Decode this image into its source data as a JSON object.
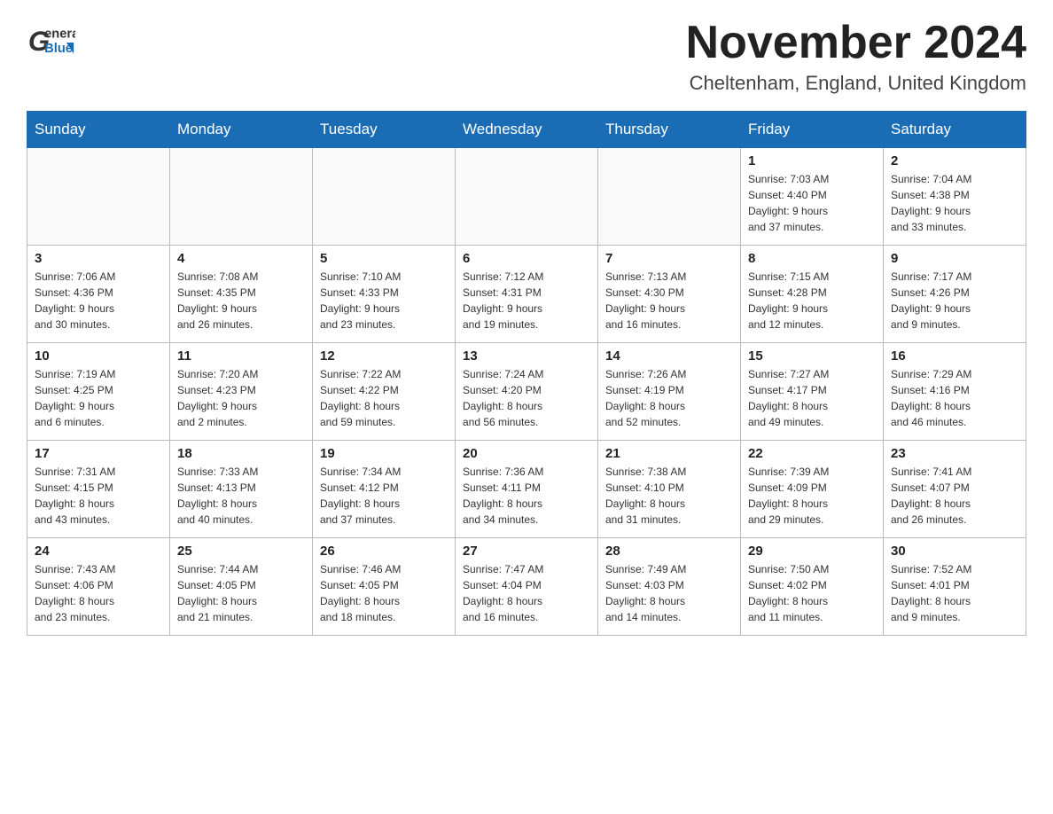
{
  "header": {
    "month_title": "November 2024",
    "location": "Cheltenham, England, United Kingdom",
    "logo_general": "General",
    "logo_blue": "Blue"
  },
  "days_of_week": [
    "Sunday",
    "Monday",
    "Tuesday",
    "Wednesday",
    "Thursday",
    "Friday",
    "Saturday"
  ],
  "weeks": [
    {
      "days": [
        {
          "number": "",
          "info": ""
        },
        {
          "number": "",
          "info": ""
        },
        {
          "number": "",
          "info": ""
        },
        {
          "number": "",
          "info": ""
        },
        {
          "number": "",
          "info": ""
        },
        {
          "number": "1",
          "info": "Sunrise: 7:03 AM\nSunset: 4:40 PM\nDaylight: 9 hours\nand 37 minutes."
        },
        {
          "number": "2",
          "info": "Sunrise: 7:04 AM\nSunset: 4:38 PM\nDaylight: 9 hours\nand 33 minutes."
        }
      ]
    },
    {
      "days": [
        {
          "number": "3",
          "info": "Sunrise: 7:06 AM\nSunset: 4:36 PM\nDaylight: 9 hours\nand 30 minutes."
        },
        {
          "number": "4",
          "info": "Sunrise: 7:08 AM\nSunset: 4:35 PM\nDaylight: 9 hours\nand 26 minutes."
        },
        {
          "number": "5",
          "info": "Sunrise: 7:10 AM\nSunset: 4:33 PM\nDaylight: 9 hours\nand 23 minutes."
        },
        {
          "number": "6",
          "info": "Sunrise: 7:12 AM\nSunset: 4:31 PM\nDaylight: 9 hours\nand 19 minutes."
        },
        {
          "number": "7",
          "info": "Sunrise: 7:13 AM\nSunset: 4:30 PM\nDaylight: 9 hours\nand 16 minutes."
        },
        {
          "number": "8",
          "info": "Sunrise: 7:15 AM\nSunset: 4:28 PM\nDaylight: 9 hours\nand 12 minutes."
        },
        {
          "number": "9",
          "info": "Sunrise: 7:17 AM\nSunset: 4:26 PM\nDaylight: 9 hours\nand 9 minutes."
        }
      ]
    },
    {
      "days": [
        {
          "number": "10",
          "info": "Sunrise: 7:19 AM\nSunset: 4:25 PM\nDaylight: 9 hours\nand 6 minutes."
        },
        {
          "number": "11",
          "info": "Sunrise: 7:20 AM\nSunset: 4:23 PM\nDaylight: 9 hours\nand 2 minutes."
        },
        {
          "number": "12",
          "info": "Sunrise: 7:22 AM\nSunset: 4:22 PM\nDaylight: 8 hours\nand 59 minutes."
        },
        {
          "number": "13",
          "info": "Sunrise: 7:24 AM\nSunset: 4:20 PM\nDaylight: 8 hours\nand 56 minutes."
        },
        {
          "number": "14",
          "info": "Sunrise: 7:26 AM\nSunset: 4:19 PM\nDaylight: 8 hours\nand 52 minutes."
        },
        {
          "number": "15",
          "info": "Sunrise: 7:27 AM\nSunset: 4:17 PM\nDaylight: 8 hours\nand 49 minutes."
        },
        {
          "number": "16",
          "info": "Sunrise: 7:29 AM\nSunset: 4:16 PM\nDaylight: 8 hours\nand 46 minutes."
        }
      ]
    },
    {
      "days": [
        {
          "number": "17",
          "info": "Sunrise: 7:31 AM\nSunset: 4:15 PM\nDaylight: 8 hours\nand 43 minutes."
        },
        {
          "number": "18",
          "info": "Sunrise: 7:33 AM\nSunset: 4:13 PM\nDaylight: 8 hours\nand 40 minutes."
        },
        {
          "number": "19",
          "info": "Sunrise: 7:34 AM\nSunset: 4:12 PM\nDaylight: 8 hours\nand 37 minutes."
        },
        {
          "number": "20",
          "info": "Sunrise: 7:36 AM\nSunset: 4:11 PM\nDaylight: 8 hours\nand 34 minutes."
        },
        {
          "number": "21",
          "info": "Sunrise: 7:38 AM\nSunset: 4:10 PM\nDaylight: 8 hours\nand 31 minutes."
        },
        {
          "number": "22",
          "info": "Sunrise: 7:39 AM\nSunset: 4:09 PM\nDaylight: 8 hours\nand 29 minutes."
        },
        {
          "number": "23",
          "info": "Sunrise: 7:41 AM\nSunset: 4:07 PM\nDaylight: 8 hours\nand 26 minutes."
        }
      ]
    },
    {
      "days": [
        {
          "number": "24",
          "info": "Sunrise: 7:43 AM\nSunset: 4:06 PM\nDaylight: 8 hours\nand 23 minutes."
        },
        {
          "number": "25",
          "info": "Sunrise: 7:44 AM\nSunset: 4:05 PM\nDaylight: 8 hours\nand 21 minutes."
        },
        {
          "number": "26",
          "info": "Sunrise: 7:46 AM\nSunset: 4:05 PM\nDaylight: 8 hours\nand 18 minutes."
        },
        {
          "number": "27",
          "info": "Sunrise: 7:47 AM\nSunset: 4:04 PM\nDaylight: 8 hours\nand 16 minutes."
        },
        {
          "number": "28",
          "info": "Sunrise: 7:49 AM\nSunset: 4:03 PM\nDaylight: 8 hours\nand 14 minutes."
        },
        {
          "number": "29",
          "info": "Sunrise: 7:50 AM\nSunset: 4:02 PM\nDaylight: 8 hours\nand 11 minutes."
        },
        {
          "number": "30",
          "info": "Sunrise: 7:52 AM\nSunset: 4:01 PM\nDaylight: 8 hours\nand 9 minutes."
        }
      ]
    }
  ]
}
